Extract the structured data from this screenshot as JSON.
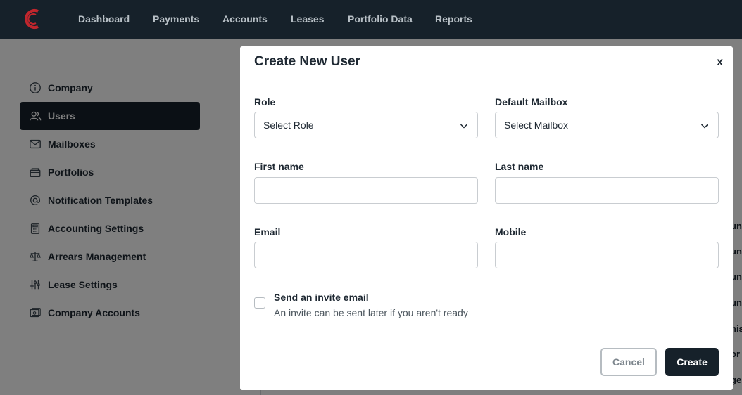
{
  "nav": {
    "items": [
      "Dashboard",
      "Payments",
      "Accounts",
      "Leases",
      "Portfolio Data",
      "Reports"
    ],
    "accent_color": "#c0262d"
  },
  "sidebar": {
    "items": [
      {
        "label": "Company",
        "icon": "info-icon"
      },
      {
        "label": "Users",
        "icon": "users-icon",
        "active": true
      },
      {
        "label": "Mailboxes",
        "icon": "mail-icon"
      },
      {
        "label": "Portfolios",
        "icon": "briefcase-icon"
      },
      {
        "label": "Notification Templates",
        "icon": "at-icon"
      },
      {
        "label": "Accounting Settings",
        "icon": "calculator-icon"
      },
      {
        "label": "Arrears Management",
        "icon": "scale-icon"
      },
      {
        "label": "Lease Settings",
        "icon": "sliders-icon"
      },
      {
        "label": "Company Accounts",
        "icon": "bank-icon"
      }
    ]
  },
  "background_peek": [
    "unt",
    "unt",
    "unt",
    "unt",
    "his",
    "or",
    "ge"
  ],
  "modal": {
    "title": "Create New User",
    "close_label": "x",
    "role": {
      "label": "Role",
      "value": "Select Role"
    },
    "mailbox": {
      "label": "Default Mailbox",
      "value": "Select Mailbox"
    },
    "first_name": {
      "label": "First name",
      "value": "",
      "placeholder": ""
    },
    "last_name": {
      "label": "Last name",
      "value": "",
      "placeholder": ""
    },
    "email": {
      "label": "Email",
      "value": "",
      "placeholder": ""
    },
    "mobile": {
      "label": "Mobile",
      "value": "",
      "placeholder": ""
    },
    "invite": {
      "title": "Send an invite email",
      "subtitle": "An invite can be sent later if you aren't ready",
      "checked": false
    },
    "cancel_label": "Cancel",
    "create_label": "Create"
  }
}
